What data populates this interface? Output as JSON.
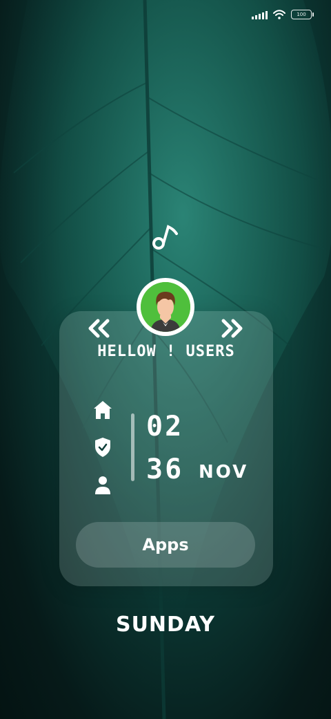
{
  "status_bar": {
    "battery_label": "100",
    "icons": [
      "signal-icon",
      "wifi-icon",
      "battery-icon"
    ]
  },
  "widget": {
    "greeting": "HELLOW ! USERS",
    "hour": "02",
    "minute": "36",
    "month": "NOV",
    "apps_label": "Apps",
    "day": "SUNDAY",
    "side_icons": [
      "home-icon",
      "shield-check-icon",
      "user-icon"
    ],
    "nav_icons": [
      "chevrons-left-icon",
      "chevrons-right-icon"
    ],
    "top_icon": "music-note-icon"
  },
  "colors": {
    "accent": "#4fbf3c",
    "background_dark": "#061a19",
    "background_leaf": "#1f6e64"
  }
}
